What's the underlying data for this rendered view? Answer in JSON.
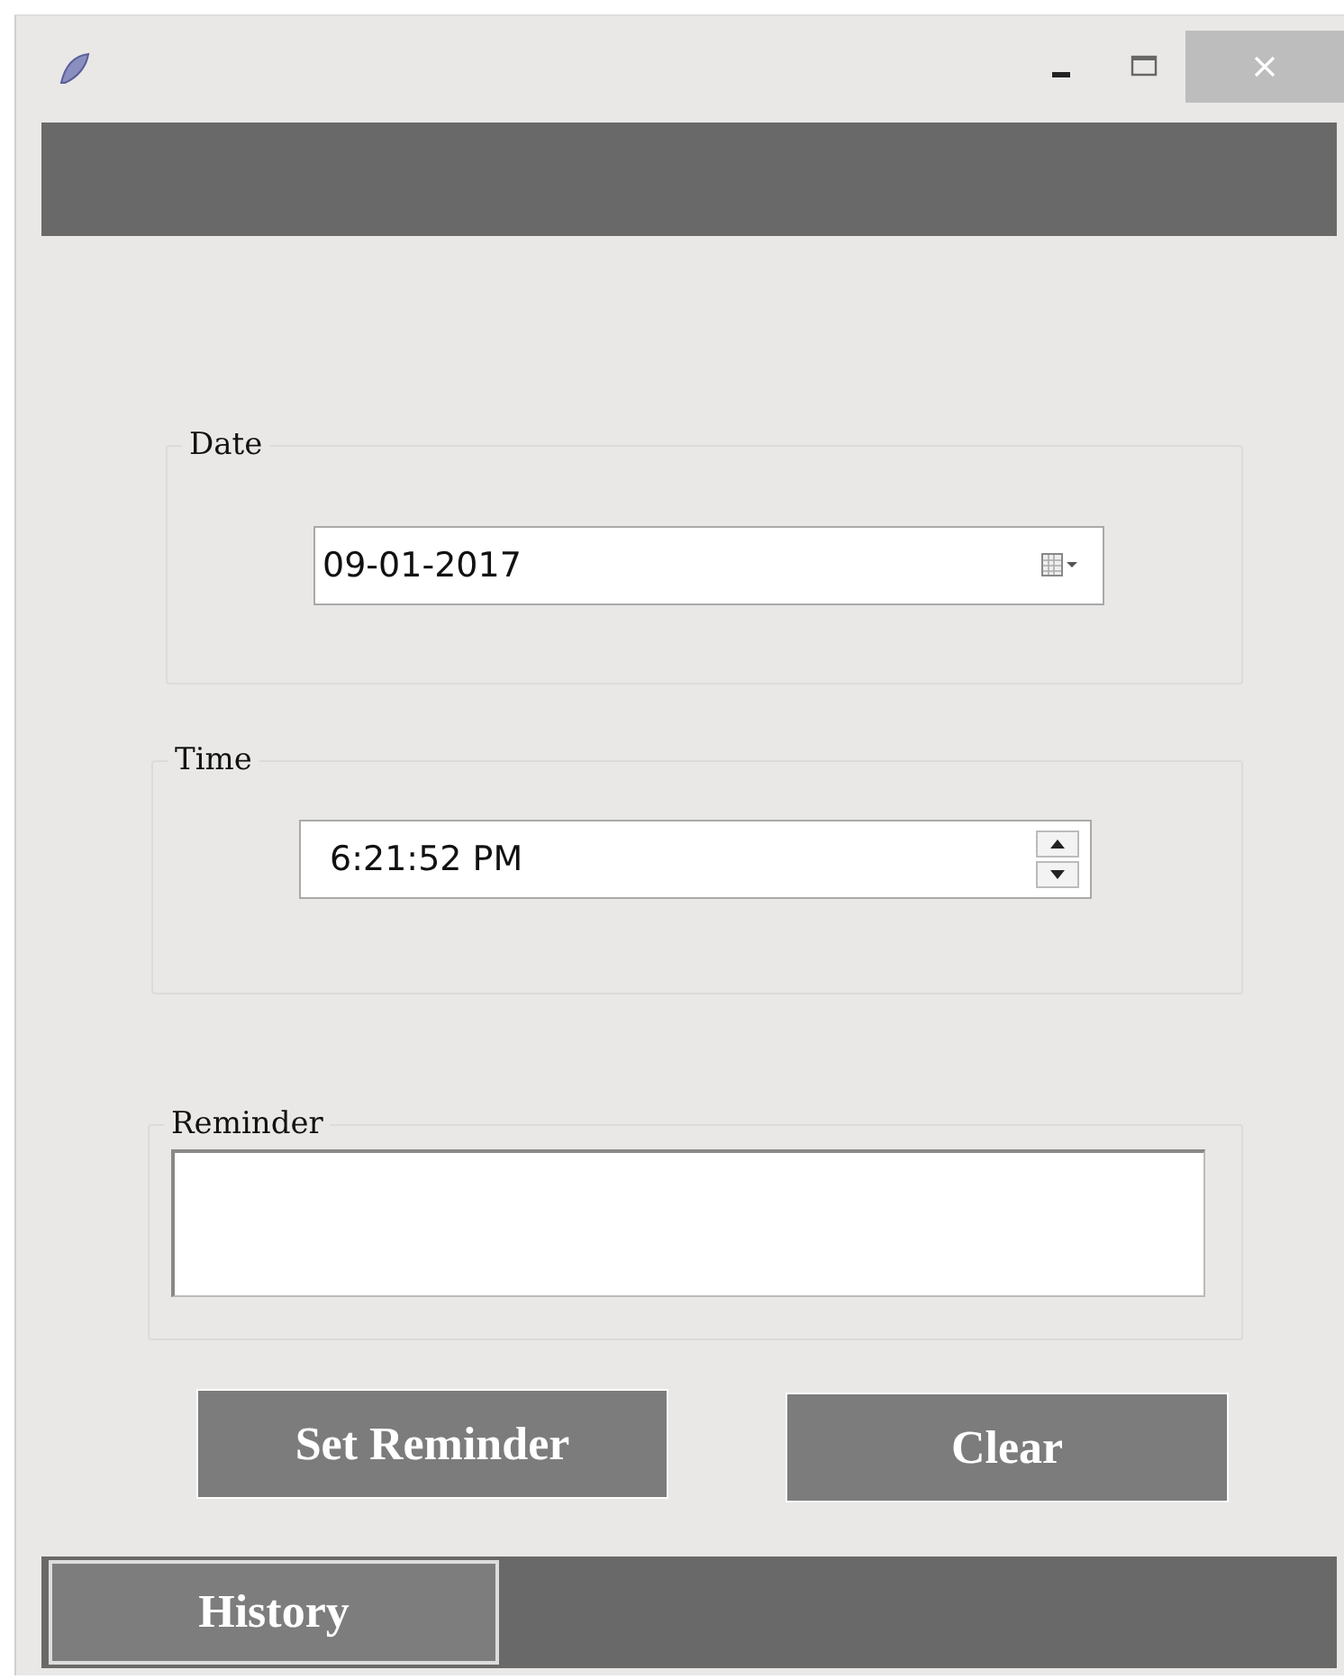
{
  "date_group": {
    "label": "Date",
    "value": "09-01-2017"
  },
  "time_group": {
    "label": "Time",
    "value": "6:21:52 PM"
  },
  "reminder_group": {
    "label": "Reminder"
  },
  "buttons": [
    "Set Reminder",
    "Clear"
  ],
  "footer": {
    "history_button": "History"
  }
}
